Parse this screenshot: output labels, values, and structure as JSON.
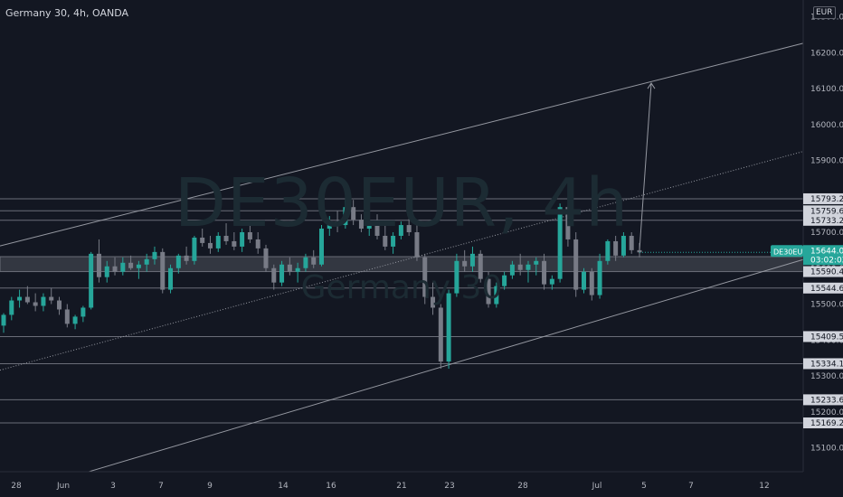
{
  "header": {
    "title": "Germany 30, 4h, OANDA"
  },
  "watermark": {
    "symbol": "DE30EUR, 4h",
    "name": "Germany 30"
  },
  "currency_button": "EUR",
  "colors": {
    "background": "#131722",
    "up": "#26a69a",
    "down": "#787b86",
    "line": "#b2b5be",
    "zone": "#3a3d46",
    "last_price": "#26a69a"
  },
  "chart_data": {
    "type": "candlestick",
    "symbol": "DE30EUR",
    "interval": "4h",
    "ylim": [
      15030,
      16330
    ],
    "y_ticks": [
      "15100.0",
      "15200.0",
      "15300.0",
      "15400.0",
      "15500.0",
      "15600.0",
      "15700.0",
      "15800.0",
      "15900.0",
      "16000.0",
      "16100.0",
      "16200.0",
      "16300.0"
    ],
    "x_ticks": [
      "28",
      "Jun",
      "3",
      "7",
      "9",
      "14",
      "16",
      "21",
      "23",
      "28",
      "Jul",
      "5",
      "7",
      "12"
    ],
    "level_labels": [
      "15793.2",
      "15759.6",
      "15733.2",
      "15590.4",
      "15544.6",
      "15409.5",
      "15334.1",
      "15233.6",
      "15169.2"
    ],
    "last_price": {
      "symbol": "DE30EUR",
      "price": "15644.0",
      "countdown": "03:02:02"
    },
    "price_lines": [
      15793.2,
      15759.6,
      15733.2,
      15544.6,
      15409.5,
      15334.1,
      15233.6,
      15169.2
    ],
    "zone": [
      15590.4,
      15632
    ],
    "candles": [
      [
        15440,
        15475,
        15420,
        15470
      ],
      [
        15470,
        15520,
        15455,
        15510
      ],
      [
        15510,
        15540,
        15490,
        15520
      ],
      [
        15520,
        15550,
        15500,
        15505
      ],
      [
        15505,
        15530,
        15480,
        15495
      ],
      [
        15495,
        15530,
        15480,
        15520
      ],
      [
        15520,
        15545,
        15500,
        15510
      ],
      [
        15510,
        15520,
        15470,
        15485
      ],
      [
        15485,
        15500,
        15435,
        15445
      ],
      [
        15445,
        15470,
        15430,
        15465
      ],
      [
        15465,
        15495,
        15450,
        15490
      ],
      [
        15490,
        15645,
        15485,
        15640
      ],
      [
        15640,
        15680,
        15560,
        15575
      ],
      [
        15575,
        15620,
        15560,
        15605
      ],
      [
        15605,
        15630,
        15580,
        15590
      ],
      [
        15590,
        15630,
        15580,
        15615
      ],
      [
        15615,
        15635,
        15595,
        15600
      ],
      [
        15600,
        15620,
        15570,
        15610
      ],
      [
        15610,
        15640,
        15590,
        15625
      ],
      [
        15625,
        15660,
        15610,
        15645
      ],
      [
        15645,
        15655,
        15530,
        15540
      ],
      [
        15540,
        15610,
        15530,
        15600
      ],
      [
        15600,
        15640,
        15585,
        15635
      ],
      [
        15635,
        15660,
        15610,
        15620
      ],
      [
        15620,
        15690,
        15610,
        15685
      ],
      [
        15685,
        15710,
        15660,
        15670
      ],
      [
        15670,
        15690,
        15640,
        15655
      ],
      [
        15655,
        15700,
        15645,
        15690
      ],
      [
        15690,
        15725,
        15665,
        15675
      ],
      [
        15675,
        15700,
        15650,
        15660
      ],
      [
        15660,
        15710,
        15645,
        15700
      ],
      [
        15700,
        15720,
        15670,
        15680
      ],
      [
        15680,
        15700,
        15640,
        15655
      ],
      [
        15655,
        15665,
        15590,
        15600
      ],
      [
        15600,
        15610,
        15540,
        15560
      ],
      [
        15560,
        15620,
        15550,
        15610
      ],
      [
        15610,
        15630,
        15580,
        15590
      ],
      [
        15590,
        15615,
        15560,
        15600
      ],
      [
        15600,
        15640,
        15590,
        15630
      ],
      [
        15630,
        15650,
        15600,
        15610
      ],
      [
        15610,
        15720,
        15605,
        15710
      ],
      [
        15710,
        15745,
        15690,
        15730
      ],
      [
        15730,
        15760,
        15700,
        15720
      ],
      [
        15720,
        15790,
        15710,
        15770
      ],
      [
        15770,
        15790,
        15720,
        15735
      ],
      [
        15735,
        15750,
        15700,
        15710
      ],
      [
        15710,
        15740,
        15690,
        15730
      ],
      [
        15730,
        15750,
        15680,
        15690
      ],
      [
        15690,
        15720,
        15650,
        15660
      ],
      [
        15660,
        15700,
        15640,
        15690
      ],
      [
        15690,
        15730,
        15680,
        15720
      ],
      [
        15720,
        15745,
        15690,
        15700
      ],
      [
        15700,
        15720,
        15620,
        15630
      ],
      [
        15630,
        15640,
        15500,
        15520
      ],
      [
        15520,
        15560,
        15470,
        15490
      ],
      [
        15490,
        15500,
        15320,
        15340
      ],
      [
        15340,
        15540,
        15320,
        15530
      ],
      [
        15530,
        15640,
        15520,
        15620
      ],
      [
        15620,
        15650,
        15590,
        15605
      ],
      [
        15605,
        15660,
        15590,
        15640
      ],
      [
        15640,
        15650,
        15560,
        15570
      ],
      [
        15570,
        15590,
        15490,
        15500
      ],
      [
        15500,
        15560,
        15490,
        15550
      ],
      [
        15550,
        15590,
        15540,
        15580
      ],
      [
        15580,
        15620,
        15570,
        15610
      ],
      [
        15610,
        15640,
        15580,
        15595
      ],
      [
        15595,
        15620,
        15560,
        15610
      ],
      [
        15610,
        15630,
        15580,
        15620
      ],
      [
        15620,
        15640,
        15540,
        15555
      ],
      [
        15555,
        15580,
        15540,
        15570
      ],
      [
        15570,
        15780,
        15560,
        15770
      ],
      [
        15770,
        15775,
        15660,
        15680
      ],
      [
        15680,
        15700,
        15520,
        15540
      ],
      [
        15540,
        15600,
        15530,
        15590
      ],
      [
        15590,
        15600,
        15510,
        15525
      ],
      [
        15525,
        15640,
        15515,
        15620
      ],
      [
        15620,
        15680,
        15610,
        15675
      ],
      [
        15675,
        15690,
        15620,
        15635
      ],
      [
        15635,
        15700,
        15630,
        15690
      ],
      [
        15690,
        15700,
        15640,
        15650
      ],
      [
        15650,
        15670,
        15630,
        15644
      ]
    ],
    "channel_lines": [
      {
        "name": "upper",
        "from": [
          0,
          15662
        ],
        "to": [
          888,
          16226
        ]
      },
      {
        "name": "lower",
        "from": [
          0,
          14960
        ],
        "to": [
          888,
          15624
        ]
      },
      {
        "name": "mid",
        "from": [
          0,
          15316
        ],
        "to": [
          888,
          15925
        ]
      }
    ],
    "arrow": {
      "from": [
        707,
        15650
      ],
      "to": [
        720,
        16115
      ]
    }
  }
}
